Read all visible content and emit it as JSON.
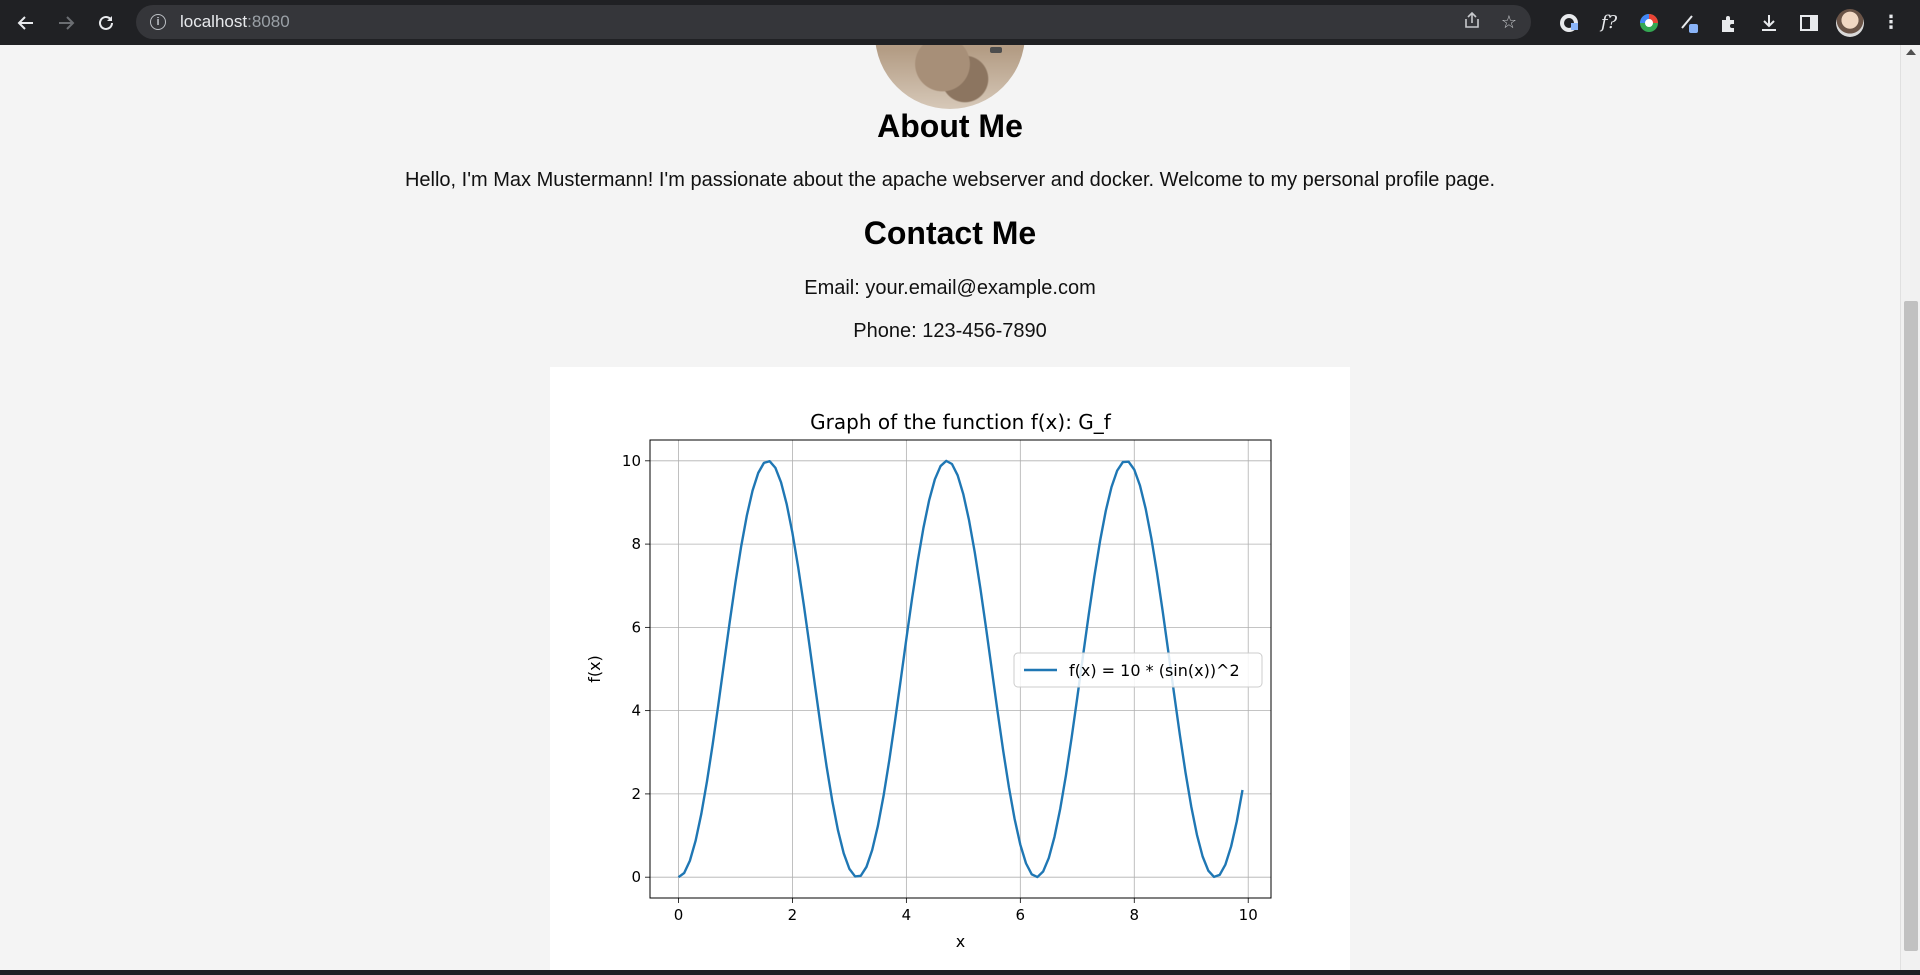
{
  "browser": {
    "url_host": "localhost",
    "url_port": ":8080",
    "icons": [
      "back-icon",
      "forward-icon",
      "reload-icon",
      "info-icon",
      "share-icon",
      "star-icon",
      "extension-icons",
      "downloads-icon",
      "side-panel-icon",
      "profile-avatar",
      "menu-icon"
    ]
  },
  "about": {
    "heading": "About Me",
    "text": "Hello, I'm Max Mustermann! I'm passionate about the apache webserver and docker. Welcome to my personal profile page."
  },
  "contact": {
    "heading": "Contact Me",
    "email": "Email: your.email@example.com",
    "phone": "Phone: 123-456-7890"
  },
  "chart_data": {
    "type": "line",
    "title": "Graph of the function f(x): G_f",
    "xlabel": "x",
    "ylabel": "f(x)",
    "xlim": [
      -0.5,
      10.4
    ],
    "ylim": [
      -0.5,
      10.5
    ],
    "xticks": [
      "0",
      "2",
      "4",
      "6",
      "8",
      "10"
    ],
    "yticks": [
      "0",
      "2",
      "4",
      "6",
      "8",
      "10"
    ],
    "grid": true,
    "legend_position": "center-right",
    "series": [
      {
        "name": "f(x) = 10 * (sin(x))^2",
        "color": "#1f77b4",
        "x_start": 0,
        "x_end": 9.9,
        "x_step": 0.1,
        "function": "10 * (sin(x))^2"
      }
    ]
  }
}
